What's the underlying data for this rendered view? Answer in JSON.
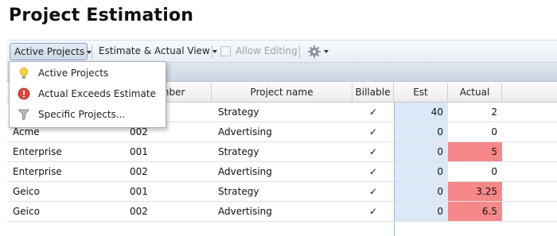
{
  "page": {
    "title": "Project Estimation"
  },
  "toolbar": {
    "active_projects_label": "Active Projects",
    "view_label": "Estimate & Actual View",
    "allow_editing_label": "Allow Editing",
    "gear_icon": "gear-icon"
  },
  "dropdown": {
    "items": [
      {
        "label": "Active Projects",
        "icon": "lightbulb-icon"
      },
      {
        "label": "Actual Exceeds Estimate",
        "icon": "alert-icon"
      },
      {
        "label": "Specific Projects...",
        "icon": "filter-funnel-icon"
      }
    ]
  },
  "grid": {
    "columns": [
      "",
      "number",
      "Project name",
      "Billable",
      "Est",
      "Actual"
    ],
    "rows": [
      {
        "client": "",
        "number": "",
        "project": "Strategy",
        "billable": "✓",
        "est": "40",
        "actual": "2",
        "over": false
      },
      {
        "client": "Acme",
        "number": "002",
        "project": "Advertising",
        "billable": "✓",
        "est": "0",
        "actual": "0",
        "over": false
      },
      {
        "client": "Enterprise",
        "number": "001",
        "project": "Strategy",
        "billable": "✓",
        "est": "0",
        "actual": "5",
        "over": true
      },
      {
        "client": "Enterprise",
        "number": "002",
        "project": "Advertising",
        "billable": "✓",
        "est": "0",
        "actual": "0",
        "over": false
      },
      {
        "client": "Geico",
        "number": "001",
        "project": "Strategy",
        "billable": "✓",
        "est": "0",
        "actual": "3.25",
        "over": true
      },
      {
        "client": "Geico",
        "number": "002",
        "project": "Advertising",
        "billable": "✓",
        "est": "0",
        "actual": "6.5",
        "over": true
      }
    ]
  },
  "colors": {
    "est_bg": "#dbe8f7",
    "over_bg": "#f7888a"
  }
}
